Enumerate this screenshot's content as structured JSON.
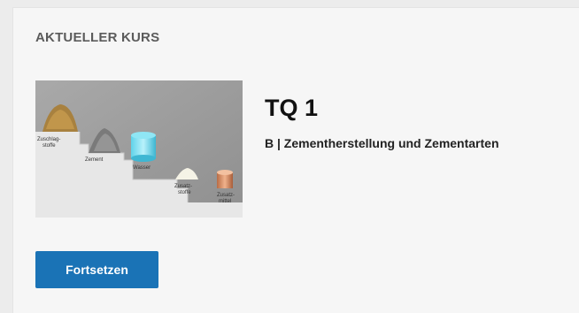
{
  "card": {
    "section_title": "AKTUELLER KURS"
  },
  "course": {
    "title": "TQ 1",
    "subtitle": "B | Zementherstellung und Zementarten",
    "image": {
      "labels": {
        "zuschlag_line1": "Zuschlag-",
        "zuschlag_line2": "stoffe",
        "zement": "Zement",
        "wasser": "Wasser",
        "zusatzstoffe_line1": "Zusatz-",
        "zusatzstoffe_line2": "stoffe",
        "zusatzmittel_line1": "Zusatz-",
        "zusatzmittel_line2": "mittel"
      }
    }
  },
  "actions": {
    "continue_label": "Fortsetzen",
    "continue_color": "#1a73b6"
  }
}
